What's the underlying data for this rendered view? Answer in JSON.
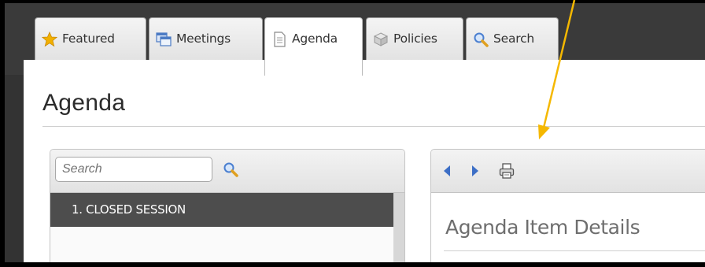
{
  "tabs": [
    {
      "label": "Featured",
      "icon": "star-icon"
    },
    {
      "label": "Meetings",
      "icon": "windows-icon"
    },
    {
      "label": "Agenda",
      "icon": "document-icon"
    },
    {
      "label": "Policies",
      "icon": "cube-icon"
    },
    {
      "label": "Search",
      "icon": "magnifier-icon"
    }
  ],
  "active_tab": "Agenda",
  "page": {
    "title": "Agenda"
  },
  "left_panel": {
    "search": {
      "placeholder": "Search",
      "value": ""
    },
    "items": [
      {
        "label": "1. CLOSED SESSION"
      }
    ]
  },
  "right_panel": {
    "toolbar": [
      "back-arrow-icon",
      "forward-arrow-icon",
      "print-icon"
    ],
    "title": "Agenda Item Details"
  },
  "annotation": {
    "type": "arrow",
    "color": "#f5b800",
    "points_to": "print-icon"
  },
  "colors": {
    "tab_bar": "#3a3a3a",
    "selected_item": "#4d4d4d",
    "nav_arrow": "#3d6fc6",
    "star": "#f2b000"
  }
}
